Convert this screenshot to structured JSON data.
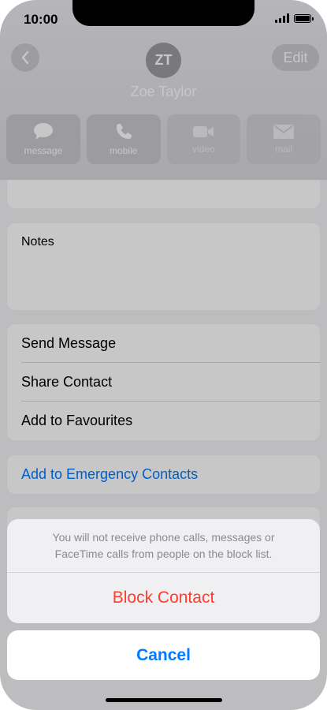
{
  "status_bar": {
    "time": "10:00"
  },
  "contact": {
    "initials": "ZT",
    "name": "Zoe Taylor",
    "edit_label": "Edit",
    "back_icon": "chevron-left-icon"
  },
  "actions": [
    {
      "label": "message",
      "icon": "message-bubble-icon",
      "enabled": true
    },
    {
      "label": "mobile",
      "icon": "phone-icon",
      "enabled": true
    },
    {
      "label": "video",
      "icon": "video-camera-icon",
      "enabled": false
    },
    {
      "label": "mail",
      "icon": "envelope-icon",
      "enabled": false
    }
  ],
  "notes": {
    "label": "Notes"
  },
  "menu": {
    "send_message": "Send Message",
    "share_contact": "Share Contact",
    "add_favourites": "Add to Favourites"
  },
  "emergency": {
    "label": "Add to Emergency Contacts"
  },
  "action_sheet": {
    "message": "You will not receive phone calls, messages or FaceTime calls from people on the block list.",
    "destructive_label": "Block Contact",
    "cancel_label": "Cancel"
  },
  "colors": {
    "accent": "#007aff",
    "destructive": "#ff3b30"
  }
}
